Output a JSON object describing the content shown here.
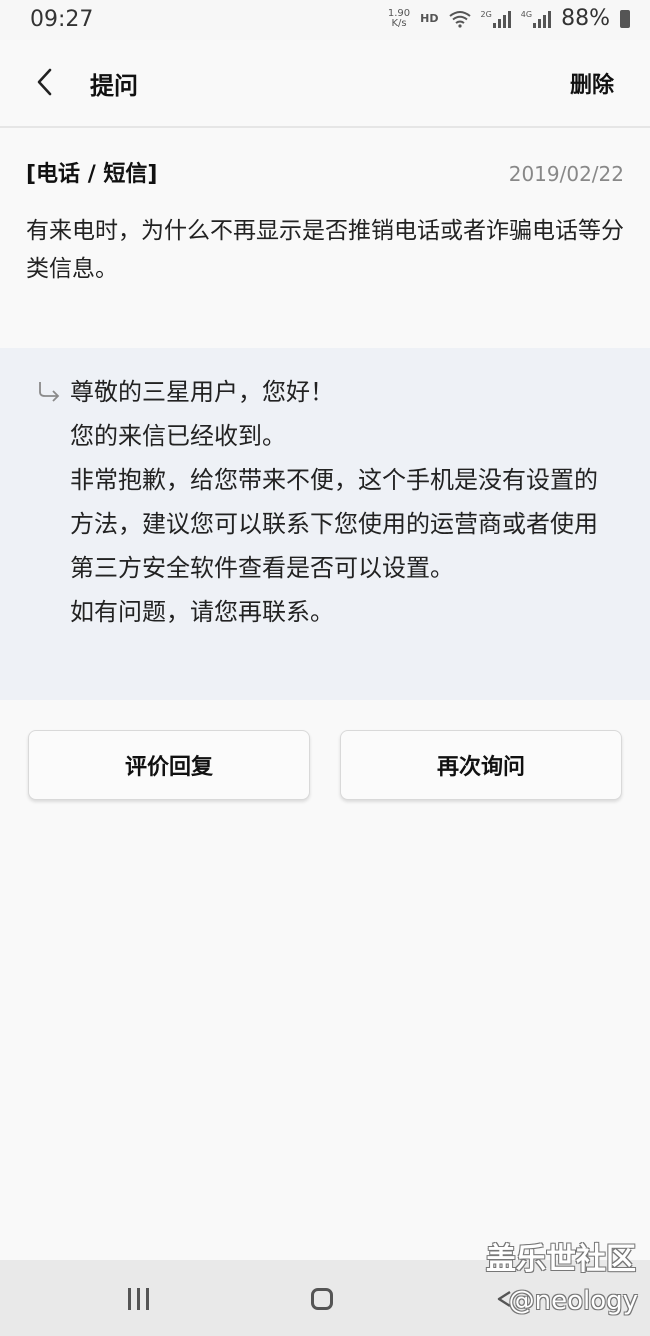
{
  "status": {
    "time": "09:27",
    "speed_value": "1.90",
    "speed_unit": "K/s",
    "hd": "HD",
    "net1": "2G",
    "net2": "4G",
    "battery": "88%"
  },
  "header": {
    "back_icon": "chevron-left-icon",
    "title": "提问",
    "delete_label": "删除"
  },
  "question": {
    "category": "[电话 / 短信]",
    "date": "2019/02/22",
    "body": "有来电时，为什么不再显示是否推销电话或者诈骗电话等分类信息。"
  },
  "answer": {
    "icon": "reply-arrow-icon",
    "lines": [
      "尊敬的三星用户，您好！",
      "您的来信已经收到。",
      "非常抱歉，给您带来不便，这个手机是没有设置的方法，建议您可以联系下您使用的运营商或者使用第三方安全软件查看是否可以设置。",
      "如有问题，请您再联系。"
    ],
    "background_color": "#eef1f6"
  },
  "actions": {
    "rate_label": "评价回复",
    "ask_again_label": "再次询问"
  },
  "navbar": {
    "recent_icon": "recent-apps-icon",
    "home_icon": "home-icon",
    "back_icon": "back-triangle-icon"
  },
  "watermark": {
    "site": "盖乐世社区",
    "user": "@neology"
  }
}
